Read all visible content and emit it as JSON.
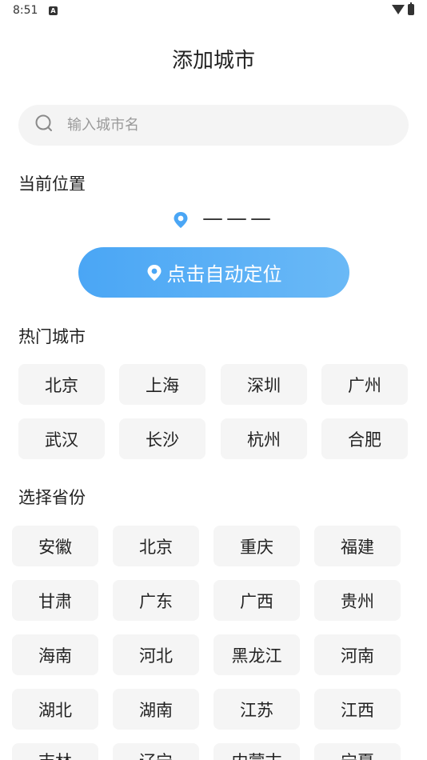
{
  "status_bar": {
    "time": "8:51",
    "notification_icon": "A"
  },
  "title": "添加城市",
  "search": {
    "placeholder": "输入城市名",
    "value": ""
  },
  "current_location": {
    "label": "当前位置",
    "value": "———",
    "pin_color": "#4aa6f5"
  },
  "auto_locate_button": {
    "label": "点击自动定位"
  },
  "hot_cities": {
    "label": "热门城市",
    "items": [
      "北京",
      "上海",
      "深圳",
      "广州",
      "武汉",
      "长沙",
      "杭州",
      "合肥"
    ]
  },
  "provinces": {
    "label": "选择省份",
    "items": [
      "安徽",
      "北京",
      "重庆",
      "福建",
      "甘肃",
      "广东",
      "广西",
      "贵州",
      "海南",
      "河北",
      "黑龙江",
      "河南",
      "湖北",
      "湖南",
      "江苏",
      "江西",
      "吉林",
      "辽宁",
      "内蒙古",
      "宁夏"
    ]
  },
  "colors": {
    "accent": "#4aa6f5",
    "chip_bg": "#f5f5f5",
    "search_bg": "#f4f4f4"
  }
}
